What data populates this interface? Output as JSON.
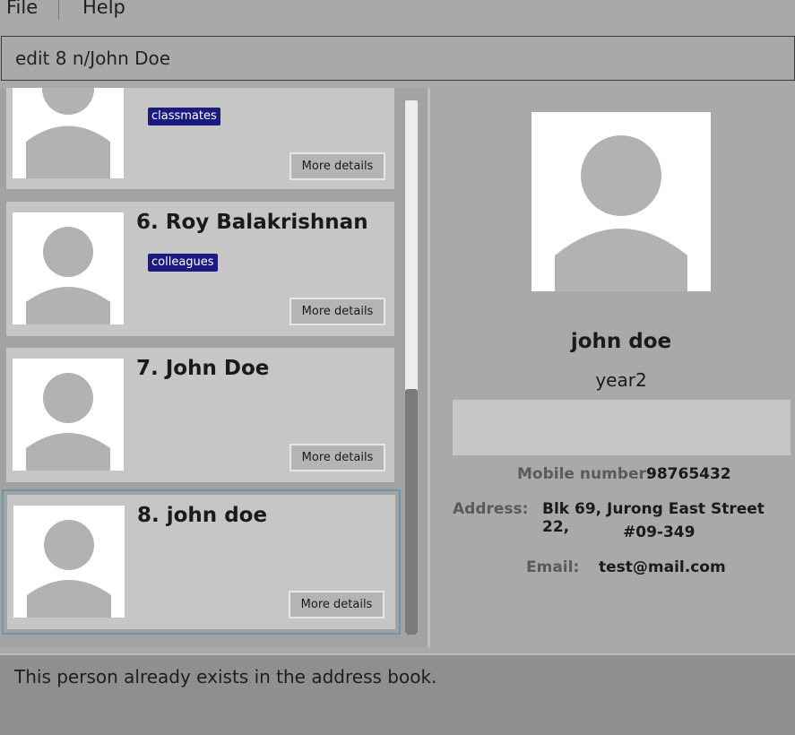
{
  "menu": {
    "file": "File",
    "help": "Help"
  },
  "command": {
    "value": "edit 8 n/John Doe"
  },
  "cards": [
    {
      "name": "",
      "tag": "classmates",
      "button": "More details"
    },
    {
      "name": "6. Roy Balakrishnan",
      "tag": "colleagues",
      "button": "More details"
    },
    {
      "name": "7. John Doe",
      "button": "More details"
    },
    {
      "name": "8. john doe",
      "button": "More details"
    }
  ],
  "detail": {
    "name": "john doe",
    "year": "year2",
    "mobile_label": "Mobile number:",
    "mobile_value": "98765432",
    "address_label": "Address:",
    "address_line1": "Blk 69, Jurong East Street 22,",
    "address_line2": "#09-349",
    "email_label": "Email:",
    "email_value": "test@mail.com"
  },
  "result": {
    "message": "This person already exists in the address book."
  },
  "colors": {
    "tag_bg": "#1a1a80",
    "card_bg": "#c6c6c6",
    "selected_outline": "#6f95a6"
  }
}
